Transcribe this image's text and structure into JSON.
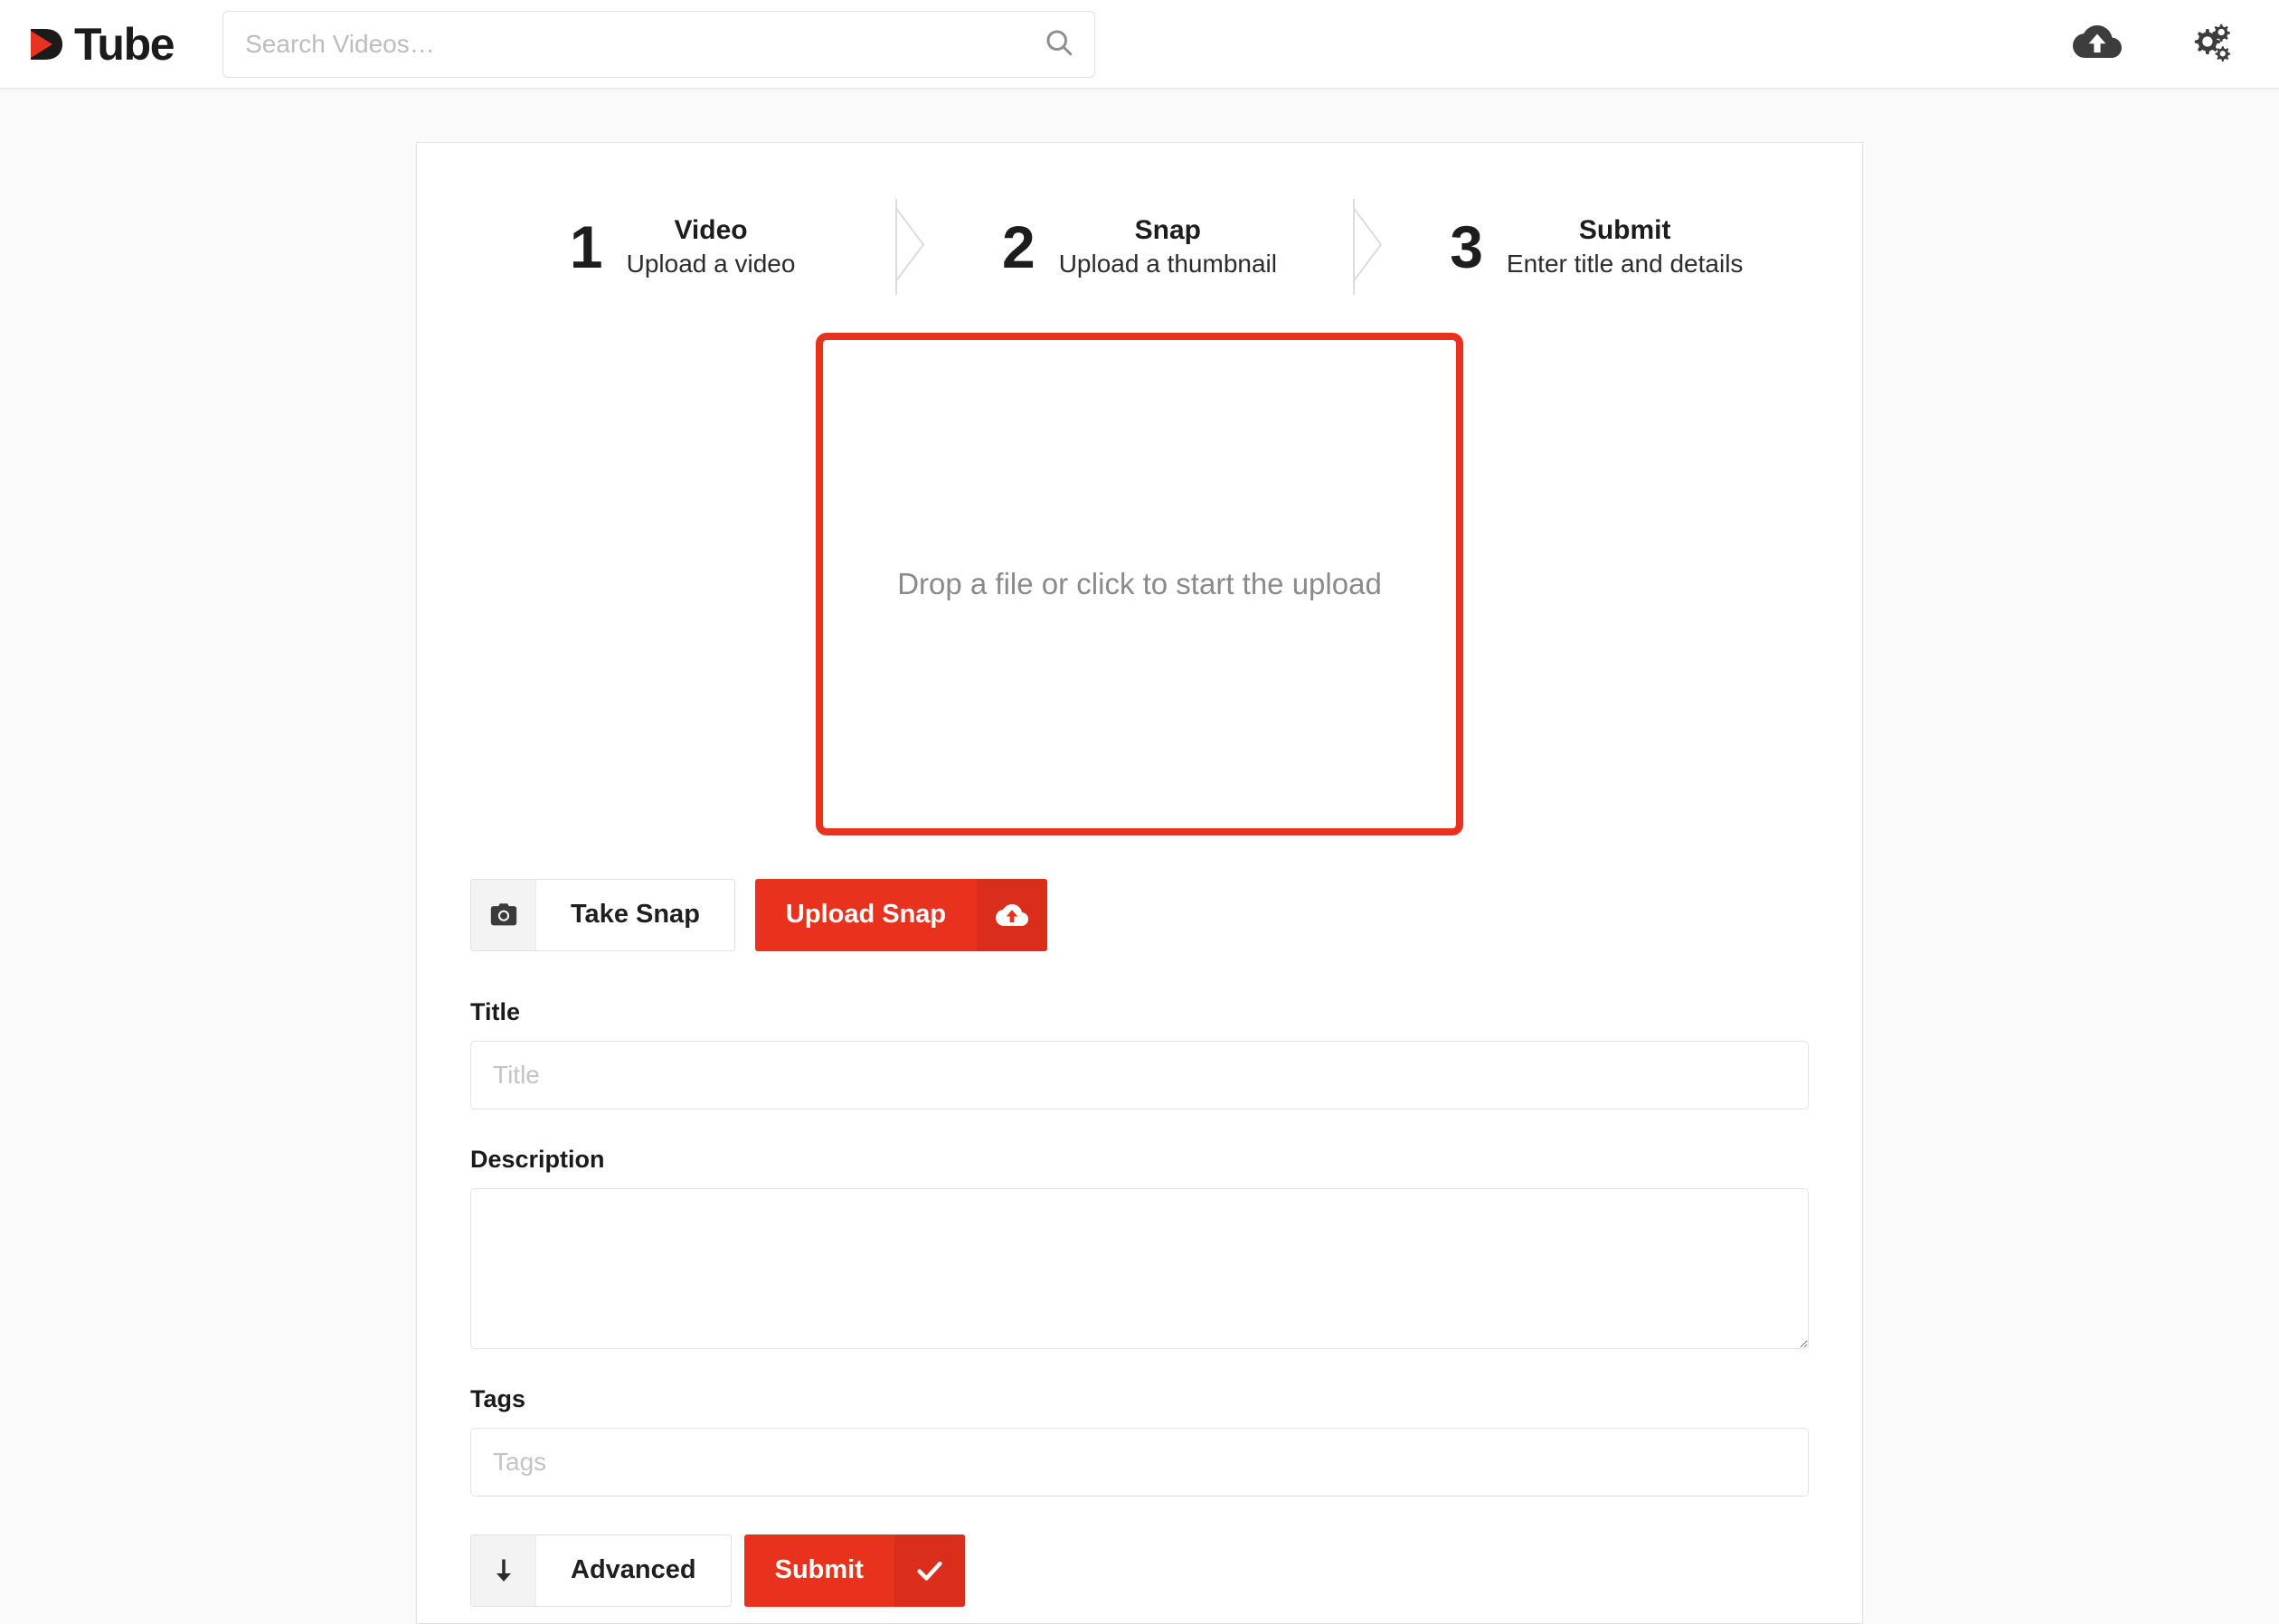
{
  "header": {
    "brand_name": "Tube",
    "logo_icon": "dtube-play-logo",
    "search": {
      "placeholder": "Search Videos…",
      "value": "",
      "icon": "search-icon"
    },
    "actions": [
      {
        "name": "upload-button",
        "icon": "cloud-upload-icon"
      },
      {
        "name": "settings-button",
        "icon": "cogs-icon"
      }
    ]
  },
  "steps": [
    {
      "number": "1",
      "title": "Video",
      "subtitle": "Upload a video"
    },
    {
      "number": "2",
      "title": "Snap",
      "subtitle": "Upload a thumbnail"
    },
    {
      "number": "3",
      "title": "Submit",
      "subtitle": "Enter title and details"
    }
  ],
  "dropzone": {
    "text": "Drop a file or click to start the upload",
    "border_color": "#e8321e"
  },
  "snap_buttons": {
    "take_snap": {
      "label": "Take Snap",
      "icon": "camera-icon"
    },
    "upload_snap": {
      "label": "Upload Snap",
      "icon": "cloud-upload-icon"
    }
  },
  "form": {
    "title": {
      "label": "Title",
      "placeholder": "Title",
      "value": ""
    },
    "description": {
      "label": "Description",
      "placeholder": "",
      "value": ""
    },
    "tags": {
      "label": "Tags",
      "placeholder": "Tags",
      "value": ""
    }
  },
  "actions": {
    "advanced": {
      "label": "Advanced",
      "icon": "arrow-down-icon"
    },
    "submit": {
      "label": "Submit",
      "icon": "check-icon"
    }
  },
  "colors": {
    "accent": "#e8321e",
    "accent_dark": "#da2d1c",
    "page_bg": "#fafafa",
    "text": "#1d1d1d",
    "muted": "#8a8a8a"
  }
}
